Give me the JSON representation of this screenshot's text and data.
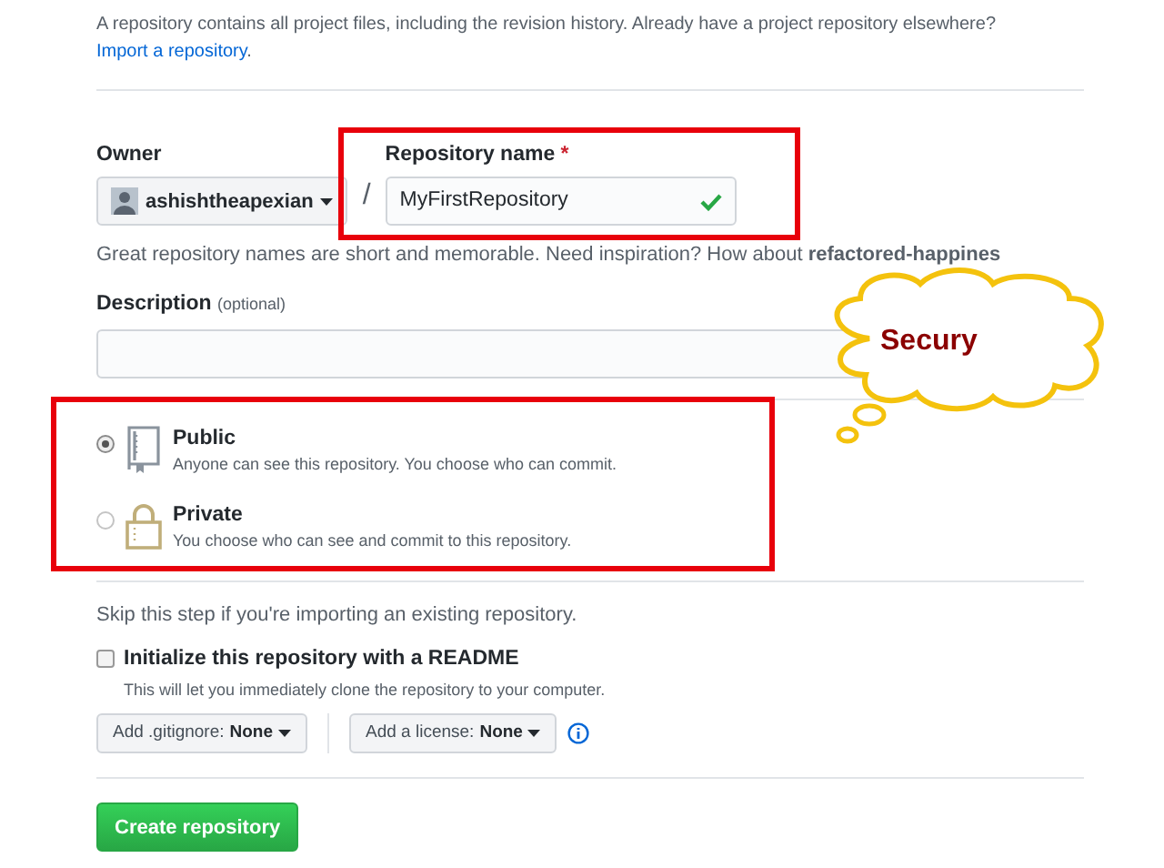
{
  "intro": {
    "text": "A repository contains all project files, including the revision history. Already have a project repository elsewhere?",
    "link": "Import a repository",
    "link_end": "."
  },
  "owner": {
    "label": "Owner",
    "value": "ashishtheapexian"
  },
  "separator": "/",
  "repo_name": {
    "label": "Repository name",
    "required": "*",
    "value": "MyFirstRepository",
    "valid": true
  },
  "hint": "Great repository names are short and memorable. Need inspiration? How about **refactored-happines**",
  "description": {
    "label": "Description",
    "optional": "(optional)"
  },
  "visibility": [
    {
      "kind": "book",
      "title": "Public",
      "description": "Anyone can see this repository. You choose who can commit.",
      "selected": true
    },
    {
      "kind": "lock",
      "title": "Private",
      "description": "You choose who can see and commit to this repository.",
      "selected": false
    }
  ],
  "skip_note": "Skip this step if you're importing an existing repository.",
  "readme": {
    "label": "Initialize this repository with a README",
    "description": "This will let you immediately clone the repository to your computer.",
    "checked": false
  },
  "dropdowns": [
    {
      "label": "Add .gitignore:",
      "value": "None"
    },
    {
      "label": "Add a license:",
      "value": "None"
    }
  ],
  "submit": "Create repository",
  "callout": "Secury"
}
